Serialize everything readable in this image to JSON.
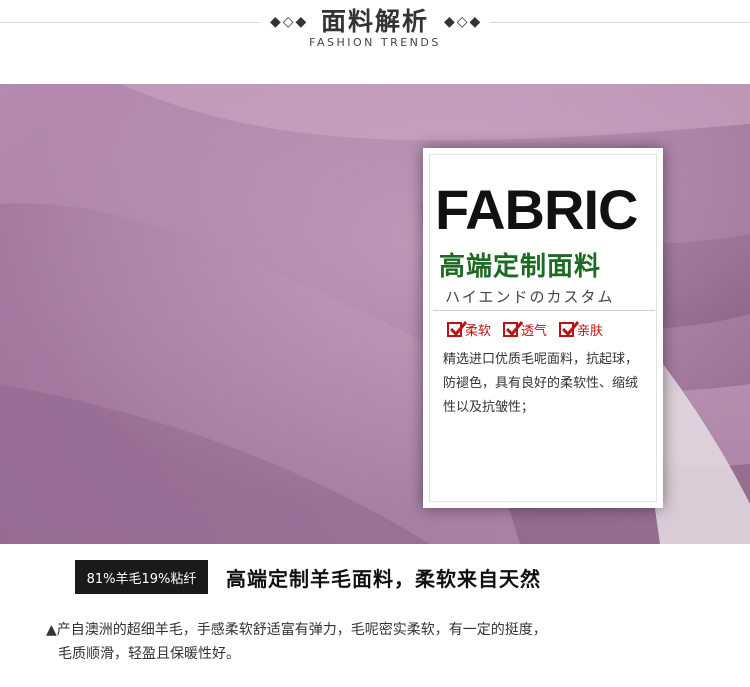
{
  "header": {
    "title": "面料解析",
    "subtitle": "FASHION TRENDS",
    "ornament_left": "◆◇◆",
    "ornament_right": "◆◇◆"
  },
  "card": {
    "word": "FABRIC",
    "subtitle": "高端定制面料",
    "japanese": "ハイエンドのカスタム",
    "features": [
      "柔软",
      "透气",
      "亲肤"
    ],
    "description": "精选进口优质毛呢面料，抗起球，防褪色，具有良好的柔软性、缩绒性以及抗皱性；"
  },
  "composition_tag": "81%羊毛19%粘纤",
  "headline": "高端定制羊毛面料，柔软来自天然",
  "bottom_text": {
    "line1": "▲产自澳洲的超细羊毛，手感柔软舒适富有弹力，毛呢密实柔软，有一定的挺度，",
    "line2": "毛质顺滑，轻盈且保暖性好。"
  },
  "colors": {
    "fabric": "#a97ea3",
    "check_red": "#b81414",
    "green": "#1d6b22"
  }
}
